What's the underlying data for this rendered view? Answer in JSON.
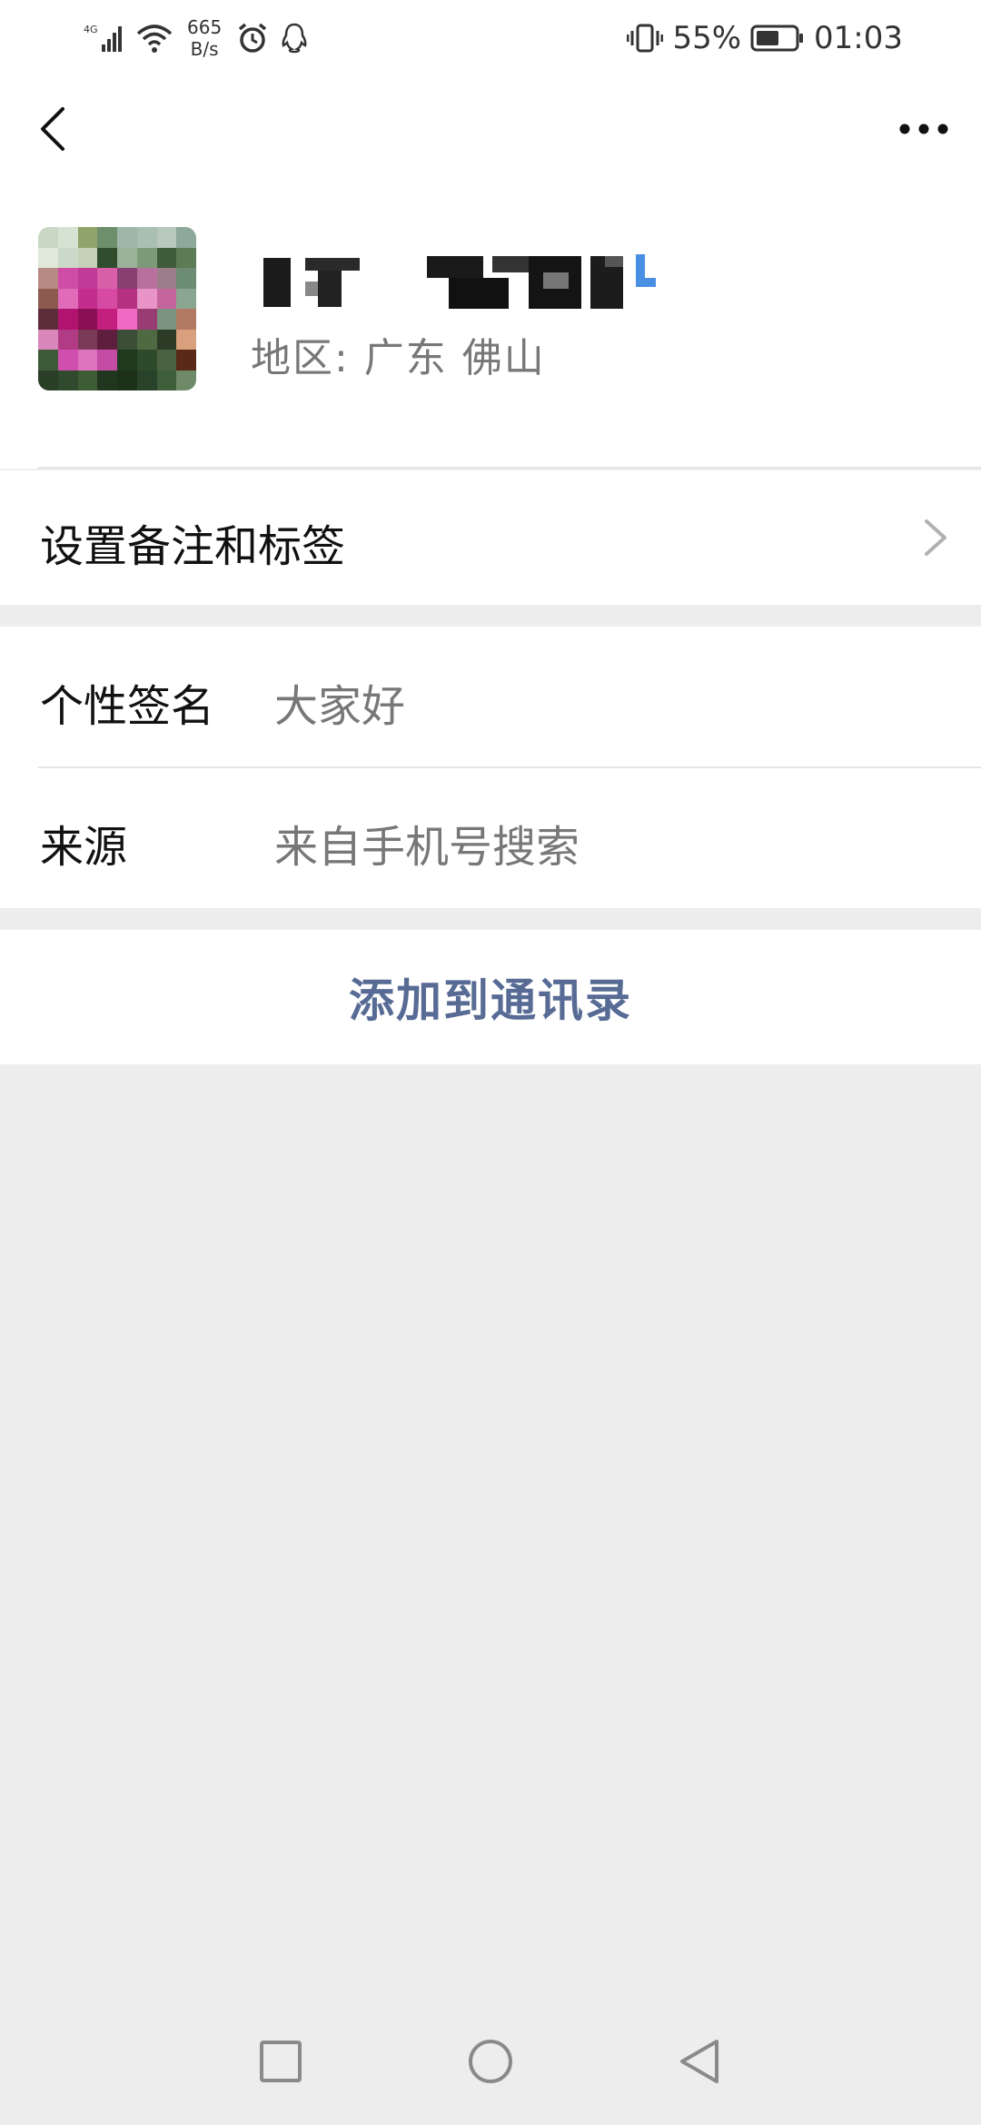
{
  "status_bar": {
    "network_type": "4G",
    "net_speed_value": "665",
    "net_speed_unit": "B/s",
    "battery": "55%",
    "time": "01:03",
    "icons": [
      "signal-icon",
      "wifi-icon",
      "alarm-icon",
      "qq-icon",
      "vibrate-icon",
      "battery-icon"
    ]
  },
  "nav": {
    "back_icon": "chevron-left-icon",
    "more_icon": "more-dots-icon"
  },
  "profile": {
    "region": "地区:  广东  佛山"
  },
  "remark_row": {
    "label": "设置备注和标签"
  },
  "info": [
    {
      "label": "个性签名",
      "value": "大家好"
    },
    {
      "label": "来源",
      "value": "来自手机号搜索"
    }
  ],
  "action": {
    "add_to_contacts": "添加到通讯录"
  },
  "colors": {
    "link_blue": "#576b95",
    "background": "#ededed",
    "secondary_text": "#777777"
  }
}
